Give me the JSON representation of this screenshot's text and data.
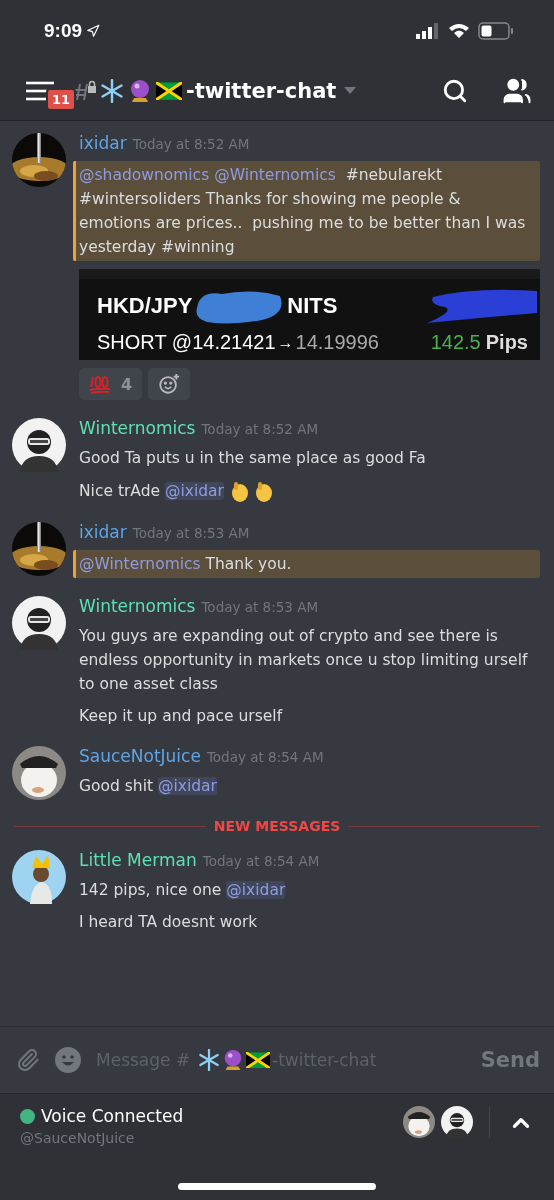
{
  "status_bar": {
    "time": "9:09"
  },
  "header": {
    "badge": "11",
    "channel": "-twitter-chat"
  },
  "messages": [
    {
      "author": "ixidar",
      "color": "#5fa4e4",
      "time": "Today at 8:52 AM",
      "highlighted": true,
      "lines": [
        {
          "kind": "plain",
          "segments": [
            {
              "kind": "mention",
              "text": "@shadownomics"
            },
            {
              "kind": "mention",
              "text": "@Winternomics"
            },
            {
              "kind": "text",
              "text": "  #nebularekt #wintersoliders Thanks for showing me people & emotions are prices..  pushing me to be better than I was yesterday #winning"
            }
          ]
        }
      ],
      "attachment": {
        "pair": "HKD/JPY",
        "units": "NITS",
        "side": "SHORT @14.21421",
        "arrow": "→",
        "close": "14.19996",
        "pips": "142.5",
        "pips_unit": "Pips"
      },
      "reactions": [
        {
          "count": "4",
          "selected": false
        }
      ]
    },
    {
      "author": "Winternomics",
      "color": "#5fe0b4",
      "time": "Today at 8:52 AM",
      "highlighted": false,
      "lines": [
        {
          "kind": "plain",
          "segments": [
            {
              "kind": "text",
              "text": "Good Ta puts u in the same place as good Fa"
            }
          ]
        },
        {
          "kind": "claps",
          "segments": [
            {
              "kind": "text",
              "text": "Nice trAde "
            },
            {
              "kind": "mention",
              "text": "@ixidar"
            }
          ]
        }
      ]
    },
    {
      "author": "ixidar",
      "color": "#5fa4e4",
      "time": "Today at 8:53 AM",
      "highlighted": true,
      "lines": [
        {
          "kind": "plain",
          "segments": [
            {
              "kind": "mention",
              "text": "@Winternomics"
            },
            {
              "kind": "text",
              "text": " Thank you."
            }
          ]
        }
      ]
    },
    {
      "author": "Winternomics",
      "color": "#5fe0b4",
      "time": "Today at 8:53 AM",
      "highlighted": false,
      "lines": [
        {
          "kind": "plain",
          "segments": [
            {
              "kind": "text",
              "text": "You guys are expanding out of crypto and see there is endless opportunity in markets once u stop limiting urself to one asset class"
            }
          ]
        },
        {
          "kind": "plain",
          "segments": [
            {
              "kind": "text",
              "text": "Keep it up and pace urself"
            }
          ]
        }
      ]
    },
    {
      "author": "SauceNotJuice",
      "color": "#5fa4e4",
      "time": "Today at 8:54 AM",
      "highlighted": false,
      "lines": [
        {
          "kind": "plain",
          "segments": [
            {
              "kind": "text",
              "text": "Good shit "
            },
            {
              "kind": "mention",
              "text": "@ixidar"
            }
          ]
        }
      ]
    },
    {
      "kind": "divider",
      "text": "NEW MESSAGES"
    },
    {
      "author": "Little Merman",
      "color": "#5fe0b4",
      "time": "Today at 8:54 AM",
      "highlighted": false,
      "lines": [
        {
          "kind": "plain",
          "segments": [
            {
              "kind": "text",
              "text": "142 pips, nice one "
            },
            {
              "kind": "mention",
              "text": "@ixidar"
            }
          ]
        },
        {
          "kind": "plain",
          "segments": [
            {
              "kind": "text",
              "text": "I heard TA doesnt work"
            }
          ]
        }
      ]
    }
  ],
  "composer": {
    "placeholder": "Message #",
    "channel": "-twitter-chat",
    "send": "Send"
  },
  "voice": {
    "title": "Voice Connected",
    "user": "@SauceNotJuice"
  }
}
